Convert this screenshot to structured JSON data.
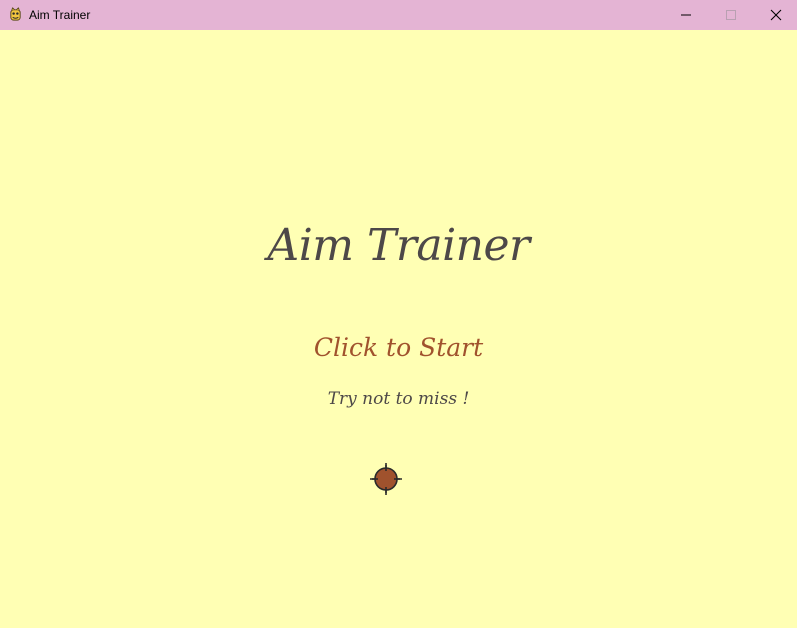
{
  "window": {
    "title": "Aim Trainer",
    "titlebar_color": "#e4b4d4",
    "app_icon": "pygame-snake-icon",
    "controls": {
      "minimize_icon": "minimize-icon",
      "maximize_icon": "maximize-icon",
      "close_icon": "close-icon"
    }
  },
  "game": {
    "background_color": "#ffffb4",
    "title": "Aim Trainer",
    "start_label": "Click to Start",
    "hint": "Try not to miss !",
    "title_color": "#4d4848",
    "accent_color": "#a0522d",
    "target_icon": "crosshair-target-icon"
  }
}
